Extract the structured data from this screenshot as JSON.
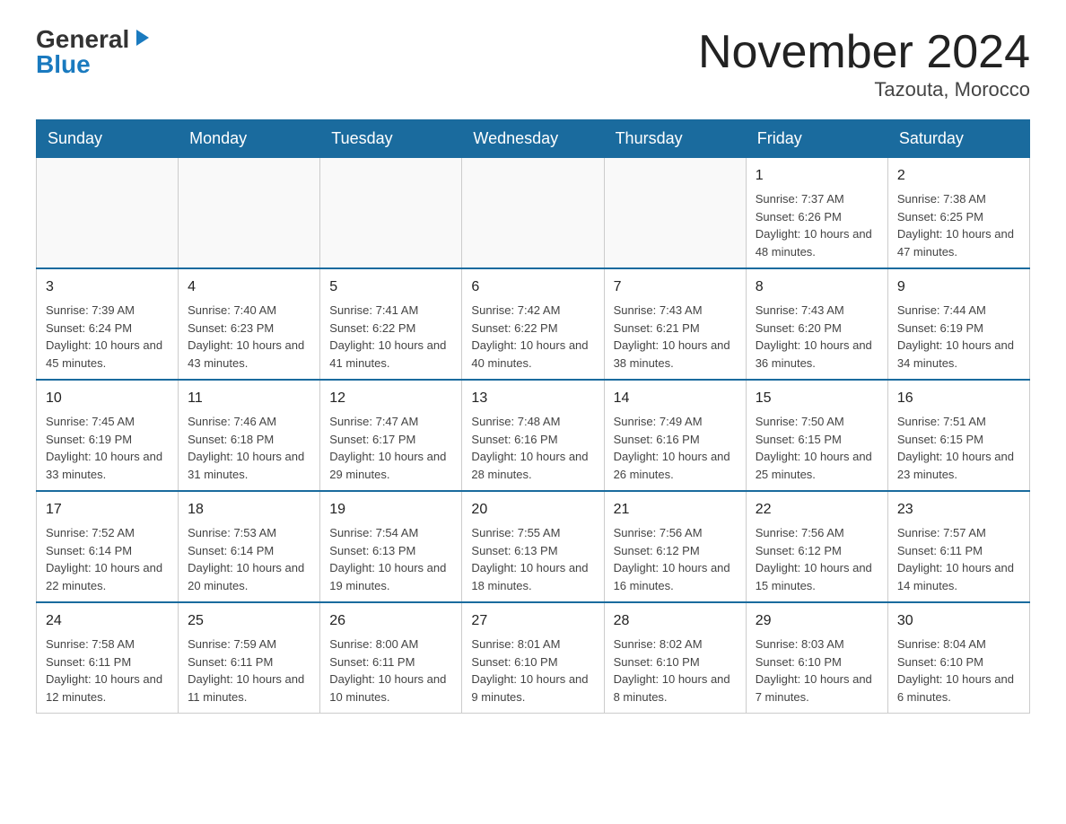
{
  "header": {
    "logo_general": "General",
    "logo_blue": "Blue",
    "month_title": "November 2024",
    "location": "Tazouta, Morocco"
  },
  "days_of_week": [
    "Sunday",
    "Monday",
    "Tuesday",
    "Wednesday",
    "Thursday",
    "Friday",
    "Saturday"
  ],
  "weeks": [
    [
      {
        "day": "",
        "sunrise": "",
        "sunset": "",
        "daylight": ""
      },
      {
        "day": "",
        "sunrise": "",
        "sunset": "",
        "daylight": ""
      },
      {
        "day": "",
        "sunrise": "",
        "sunset": "",
        "daylight": ""
      },
      {
        "day": "",
        "sunrise": "",
        "sunset": "",
        "daylight": ""
      },
      {
        "day": "",
        "sunrise": "",
        "sunset": "",
        "daylight": ""
      },
      {
        "day": "1",
        "sunrise": "Sunrise: 7:37 AM",
        "sunset": "Sunset: 6:26 PM",
        "daylight": "Daylight: 10 hours and 48 minutes."
      },
      {
        "day": "2",
        "sunrise": "Sunrise: 7:38 AM",
        "sunset": "Sunset: 6:25 PM",
        "daylight": "Daylight: 10 hours and 47 minutes."
      }
    ],
    [
      {
        "day": "3",
        "sunrise": "Sunrise: 7:39 AM",
        "sunset": "Sunset: 6:24 PM",
        "daylight": "Daylight: 10 hours and 45 minutes."
      },
      {
        "day": "4",
        "sunrise": "Sunrise: 7:40 AM",
        "sunset": "Sunset: 6:23 PM",
        "daylight": "Daylight: 10 hours and 43 minutes."
      },
      {
        "day": "5",
        "sunrise": "Sunrise: 7:41 AM",
        "sunset": "Sunset: 6:22 PM",
        "daylight": "Daylight: 10 hours and 41 minutes."
      },
      {
        "day": "6",
        "sunrise": "Sunrise: 7:42 AM",
        "sunset": "Sunset: 6:22 PM",
        "daylight": "Daylight: 10 hours and 40 minutes."
      },
      {
        "day": "7",
        "sunrise": "Sunrise: 7:43 AM",
        "sunset": "Sunset: 6:21 PM",
        "daylight": "Daylight: 10 hours and 38 minutes."
      },
      {
        "day": "8",
        "sunrise": "Sunrise: 7:43 AM",
        "sunset": "Sunset: 6:20 PM",
        "daylight": "Daylight: 10 hours and 36 minutes."
      },
      {
        "day": "9",
        "sunrise": "Sunrise: 7:44 AM",
        "sunset": "Sunset: 6:19 PM",
        "daylight": "Daylight: 10 hours and 34 minutes."
      }
    ],
    [
      {
        "day": "10",
        "sunrise": "Sunrise: 7:45 AM",
        "sunset": "Sunset: 6:19 PM",
        "daylight": "Daylight: 10 hours and 33 minutes."
      },
      {
        "day": "11",
        "sunrise": "Sunrise: 7:46 AM",
        "sunset": "Sunset: 6:18 PM",
        "daylight": "Daylight: 10 hours and 31 minutes."
      },
      {
        "day": "12",
        "sunrise": "Sunrise: 7:47 AM",
        "sunset": "Sunset: 6:17 PM",
        "daylight": "Daylight: 10 hours and 29 minutes."
      },
      {
        "day": "13",
        "sunrise": "Sunrise: 7:48 AM",
        "sunset": "Sunset: 6:16 PM",
        "daylight": "Daylight: 10 hours and 28 minutes."
      },
      {
        "day": "14",
        "sunrise": "Sunrise: 7:49 AM",
        "sunset": "Sunset: 6:16 PM",
        "daylight": "Daylight: 10 hours and 26 minutes."
      },
      {
        "day": "15",
        "sunrise": "Sunrise: 7:50 AM",
        "sunset": "Sunset: 6:15 PM",
        "daylight": "Daylight: 10 hours and 25 minutes."
      },
      {
        "day": "16",
        "sunrise": "Sunrise: 7:51 AM",
        "sunset": "Sunset: 6:15 PM",
        "daylight": "Daylight: 10 hours and 23 minutes."
      }
    ],
    [
      {
        "day": "17",
        "sunrise": "Sunrise: 7:52 AM",
        "sunset": "Sunset: 6:14 PM",
        "daylight": "Daylight: 10 hours and 22 minutes."
      },
      {
        "day": "18",
        "sunrise": "Sunrise: 7:53 AM",
        "sunset": "Sunset: 6:14 PM",
        "daylight": "Daylight: 10 hours and 20 minutes."
      },
      {
        "day": "19",
        "sunrise": "Sunrise: 7:54 AM",
        "sunset": "Sunset: 6:13 PM",
        "daylight": "Daylight: 10 hours and 19 minutes."
      },
      {
        "day": "20",
        "sunrise": "Sunrise: 7:55 AM",
        "sunset": "Sunset: 6:13 PM",
        "daylight": "Daylight: 10 hours and 18 minutes."
      },
      {
        "day": "21",
        "sunrise": "Sunrise: 7:56 AM",
        "sunset": "Sunset: 6:12 PM",
        "daylight": "Daylight: 10 hours and 16 minutes."
      },
      {
        "day": "22",
        "sunrise": "Sunrise: 7:56 AM",
        "sunset": "Sunset: 6:12 PM",
        "daylight": "Daylight: 10 hours and 15 minutes."
      },
      {
        "day": "23",
        "sunrise": "Sunrise: 7:57 AM",
        "sunset": "Sunset: 6:11 PM",
        "daylight": "Daylight: 10 hours and 14 minutes."
      }
    ],
    [
      {
        "day": "24",
        "sunrise": "Sunrise: 7:58 AM",
        "sunset": "Sunset: 6:11 PM",
        "daylight": "Daylight: 10 hours and 12 minutes."
      },
      {
        "day": "25",
        "sunrise": "Sunrise: 7:59 AM",
        "sunset": "Sunset: 6:11 PM",
        "daylight": "Daylight: 10 hours and 11 minutes."
      },
      {
        "day": "26",
        "sunrise": "Sunrise: 8:00 AM",
        "sunset": "Sunset: 6:11 PM",
        "daylight": "Daylight: 10 hours and 10 minutes."
      },
      {
        "day": "27",
        "sunrise": "Sunrise: 8:01 AM",
        "sunset": "Sunset: 6:10 PM",
        "daylight": "Daylight: 10 hours and 9 minutes."
      },
      {
        "day": "28",
        "sunrise": "Sunrise: 8:02 AM",
        "sunset": "Sunset: 6:10 PM",
        "daylight": "Daylight: 10 hours and 8 minutes."
      },
      {
        "day": "29",
        "sunrise": "Sunrise: 8:03 AM",
        "sunset": "Sunset: 6:10 PM",
        "daylight": "Daylight: 10 hours and 7 minutes."
      },
      {
        "day": "30",
        "sunrise": "Sunrise: 8:04 AM",
        "sunset": "Sunset: 6:10 PM",
        "daylight": "Daylight: 10 hours and 6 minutes."
      }
    ]
  ]
}
